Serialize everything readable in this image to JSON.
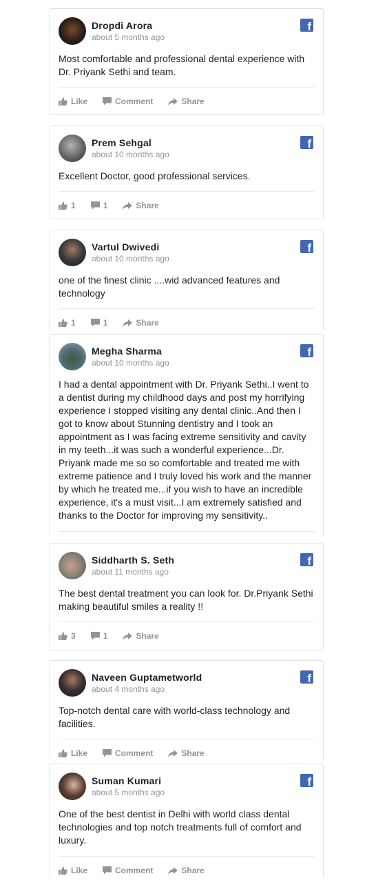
{
  "reviews": [
    {
      "name": "Dropdi Arora",
      "time": "about 5 months ago",
      "text": "Most comfortable and professional dental experience with Dr. Priyank Sethi and team.",
      "like": "Like",
      "comment": "Comment",
      "share": "Share",
      "avatar_color": "#2a1e18"
    },
    {
      "name": "Prem Sehgal",
      "time": "about 10 months ago",
      "text": "Excellent Doctor, good professional services.",
      "like": "1",
      "comment": "1",
      "share": "Share",
      "avatar_color": "#6c6a6e"
    },
    {
      "name": "Vartul Dwivedi",
      "time": "about 10 months ago",
      "text": "one of the finest clinic ....wid advanced features and technology",
      "like": "1",
      "comment": "1",
      "share": "Share",
      "avatar_color": "#3b3a3c"
    },
    {
      "name": "Megha Sharma",
      "time": "about 10 months ago",
      "text": "I had a dental appointment with Dr. Priyank Sethi..I went to a dentist during my childhood days and post my horrifying experience I stopped visiting any dental clinic..And then I got to know about Stunning dentistry and I took an appointment as I was facing extreme sensitivity and cavity in my teeth...it was such a wonderful experience...Dr. Priyank made me so so comfortable and treated me with extreme patience and I truly loved his work and the manner by which he treated me...if you wish to have an incredible experience, it's a must visit...I am extremely satisfied and thanks to the Doctor for improving my sensitivity..",
      "avatar_color": "#4f6a72"
    },
    {
      "name": "Siddharth S. Seth",
      "time": "about 11 months ago",
      "text": "The best dental treatment you can look for. Dr.Priyank Sethi making beautiful smiles a reality !!",
      "like": "3",
      "comment": "1",
      "share": "Share",
      "avatar_color": "#8a8279"
    },
    {
      "name": "Naveen Guptametworld",
      "time": "about 4 months ago",
      "text": "Top-notch dental care with world-class technology and facilities.",
      "like": "Like",
      "comment": "Comment",
      "share": "Share",
      "avatar_color": "#3a2f2d"
    },
    {
      "name": "Suman Kumari",
      "time": "about 5 months ago",
      "text": "One of the best dentist in Delhi with world class dental technologies and top notch treatments full of comfort and luxury.",
      "like": "Like",
      "comment": "Comment",
      "share": "Share",
      "avatar_color": "#5a3f33"
    }
  ],
  "facebook_color": "#4267b2",
  "facebook_glyph": "f"
}
